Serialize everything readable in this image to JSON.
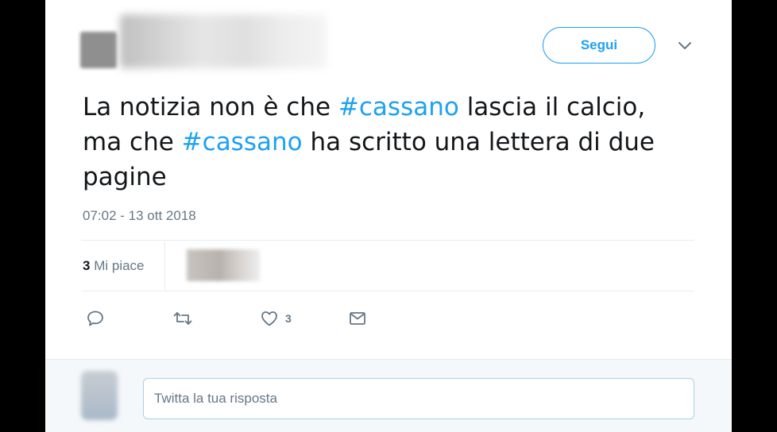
{
  "follow_label": "Segui",
  "tweet": {
    "part1": "La notizia non è che ",
    "hashtag1": "#cassano",
    "part2": " lascia il calcio,",
    "part3": "ma che ",
    "hashtag2": "#cassano",
    "part4": " ha scritto una lettera di due",
    "part5": "pagine"
  },
  "timestamp": "07:02 - 13 ott 2018",
  "stats": {
    "likes_count": "3",
    "likes_label": "Mi piace"
  },
  "actions": {
    "reply_icon": "reply-icon",
    "retweet_icon": "retweet-icon",
    "like_icon": "heart-icon",
    "like_count": "3",
    "message_icon": "envelope-icon"
  },
  "reply": {
    "placeholder": "Twitta la tua risposta"
  },
  "colors": {
    "accent": "#1da1f2",
    "text": "#14171a",
    "muted": "#657786"
  }
}
